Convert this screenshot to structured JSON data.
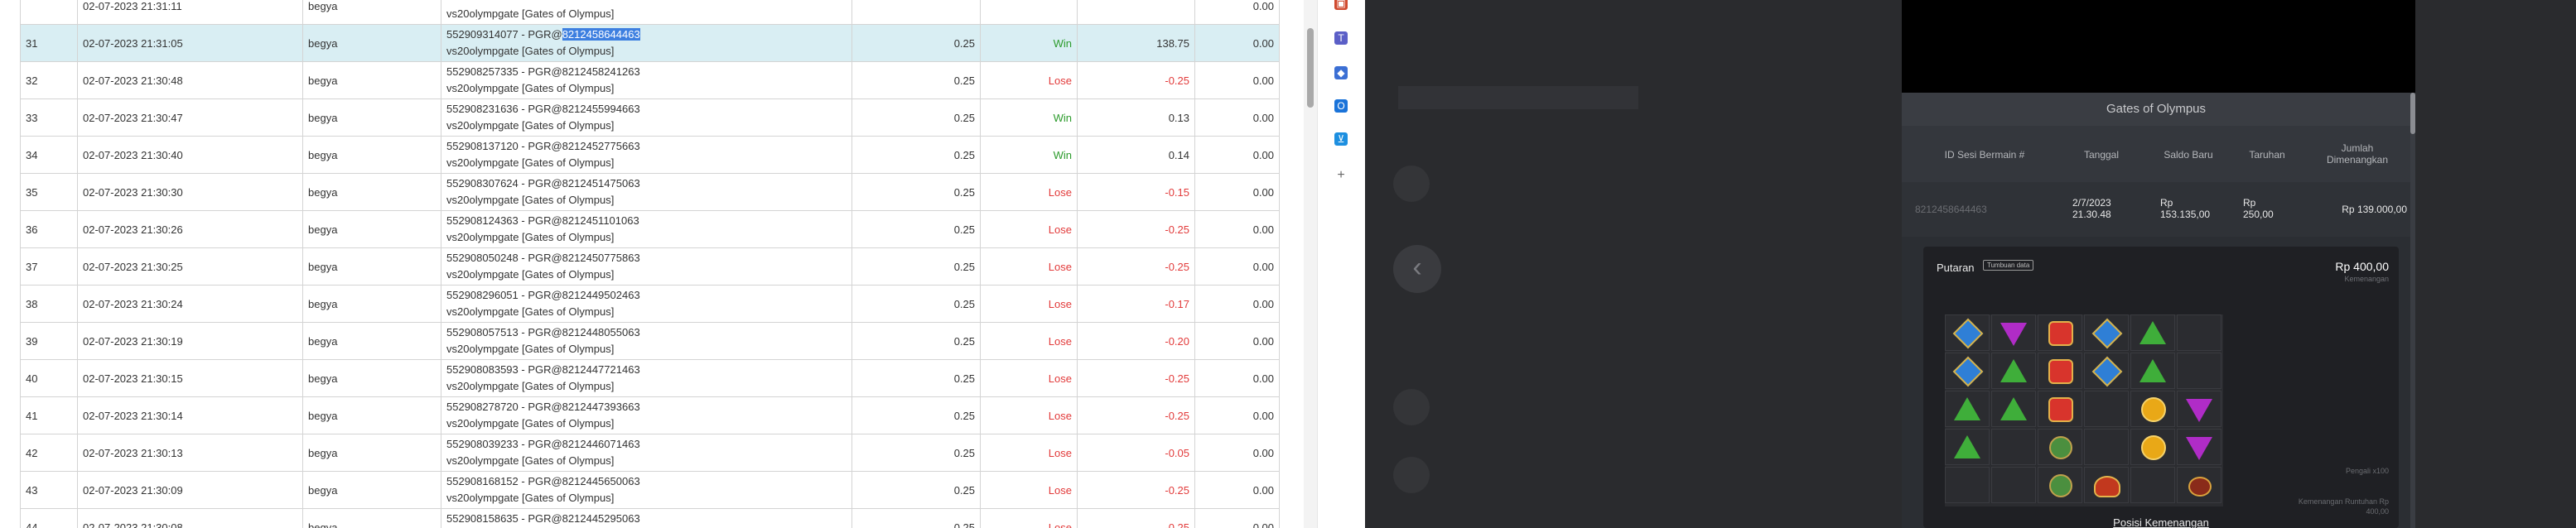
{
  "table": {
    "rows": [
      {
        "no": "31",
        "date": "02-07-2023 21:31:05",
        "user": "begya",
        "desc_pre": "552909314077 - PGR@",
        "desc_hl": "8212458644463",
        "desc2": "vs20olympgate [Gates of Olympus]",
        "bet": "0.25",
        "result": "Win",
        "amount": "138.75",
        "balance": "0.00"
      },
      {
        "no": "32",
        "date": "02-07-2023 21:30:48",
        "user": "begya",
        "desc1": "552908257335 - PGR@8212458241263",
        "desc2": "vs20olympgate [Gates of Olympus]",
        "bet": "0.25",
        "result": "Lose",
        "amount": "-0.25",
        "balance": "0.00"
      },
      {
        "no": "33",
        "date": "02-07-2023 21:30:47",
        "user": "begya",
        "desc1": "552908231636 - PGR@8212455994663",
        "desc2": "vs20olympgate [Gates of Olympus]",
        "bet": "0.25",
        "result": "Win",
        "amount": "0.13",
        "balance": "0.00"
      },
      {
        "no": "34",
        "date": "02-07-2023 21:30:40",
        "user": "begya",
        "desc1": "552908137120 - PGR@8212452775663",
        "desc2": "vs20olympgate [Gates of Olympus]",
        "bet": "0.25",
        "result": "Win",
        "amount": "0.14",
        "balance": "0.00"
      },
      {
        "no": "35",
        "date": "02-07-2023 21:30:30",
        "user": "begya",
        "desc1": "552908307624 - PGR@8212451475063",
        "desc2": "vs20olympgate [Gates of Olympus]",
        "bet": "0.25",
        "result": "Lose",
        "amount": "-0.15",
        "balance": "0.00"
      },
      {
        "no": "36",
        "date": "02-07-2023 21:30:26",
        "user": "begya",
        "desc1": "552908124363 - PGR@8212451101063",
        "desc2": "vs20olympgate [Gates of Olympus]",
        "bet": "0.25",
        "result": "Lose",
        "amount": "-0.25",
        "balance": "0.00"
      },
      {
        "no": "37",
        "date": "02-07-2023 21:30:25",
        "user": "begya",
        "desc1": "552908050248 - PGR@8212450775863",
        "desc2": "vs20olympgate [Gates of Olympus]",
        "bet": "0.25",
        "result": "Lose",
        "amount": "-0.25",
        "balance": "0.00"
      },
      {
        "no": "38",
        "date": "02-07-2023 21:30:24",
        "user": "begya",
        "desc1": "552908296051 - PGR@8212449502463",
        "desc2": "vs20olympgate [Gates of Olympus]",
        "bet": "0.25",
        "result": "Lose",
        "amount": "-0.17",
        "balance": "0.00"
      },
      {
        "no": "39",
        "date": "02-07-2023 21:30:19",
        "user": "begya",
        "desc1": "552908057513 - PGR@8212448055063",
        "desc2": "vs20olympgate [Gates of Olympus]",
        "bet": "0.25",
        "result": "Lose",
        "amount": "-0.20",
        "balance": "0.00"
      },
      {
        "no": "40",
        "date": "02-07-2023 21:30:15",
        "user": "begya",
        "desc1": "552908083593 - PGR@8212447721463",
        "desc2": "vs20olympgate [Gates of Olympus]",
        "bet": "0.25",
        "result": "Lose",
        "amount": "-0.25",
        "balance": "0.00"
      },
      {
        "no": "41",
        "date": "02-07-2023 21:30:14",
        "user": "begya",
        "desc1": "552908278720 - PGR@8212447393663",
        "desc2": "vs20olympgate [Gates of Olympus]",
        "bet": "0.25",
        "result": "Lose",
        "amount": "-0.25",
        "balance": "0.00"
      },
      {
        "no": "42",
        "date": "02-07-2023 21:30:13",
        "user": "begya",
        "desc1": "552908039233 - PGR@8212446071463",
        "desc2": "vs20olympgate [Gates of Olympus]",
        "bet": "0.25",
        "result": "Lose",
        "amount": "-0.05",
        "balance": "0.00"
      },
      {
        "no": "43",
        "date": "02-07-2023 21:30:09",
        "user": "begya",
        "desc1": "552908168152 - PGR@8212445650063",
        "desc2": "vs20olympgate [Gates of Olympus]",
        "bet": "0.25",
        "result": "Lose",
        "amount": "-0.25",
        "balance": "0.00"
      },
      {
        "no": "44",
        "date": "02-07-2023 21:30:08",
        "user": "begya",
        "desc1": "552908158635 - PGR@8212445295063",
        "desc2": "vs20olympgate [Gates of Olympus]",
        "bet": "0.25",
        "result": "Lose",
        "amount": "-0.25",
        "balance": "0.00"
      }
    ],
    "top_partial": {
      "date": "02-07-2023 21:31:11",
      "user": "begya",
      "desc2": "vs20olympgate [Gates of Olympus]",
      "balance": "0.00"
    }
  },
  "strip_icons": [
    {
      "name": "gift-icon",
      "glyph": "▣",
      "color": "#d04a2f"
    },
    {
      "name": "teams-icon",
      "glyph": "T",
      "color": "#5b5fc7"
    },
    {
      "name": "shield-icon",
      "glyph": "◆",
      "color": "#3b6fd4"
    },
    {
      "name": "outlook-icon",
      "glyph": "O",
      "color": "#1a73d9"
    },
    {
      "name": "cart-icon",
      "glyph": "⊻",
      "color": "#1d8fe0"
    },
    {
      "name": "add-icon",
      "glyph": "+",
      "color": "#666666"
    }
  ],
  "panel": {
    "title": "Gates of Olympus",
    "headers": {
      "id": "ID Sesi Bermain #",
      "date": "Tanggal",
      "balance": "Saldo Baru",
      "bet": "Taruhan",
      "win_line1": "Jumlah",
      "win_line2": "Dimenangkan"
    },
    "row": {
      "id": "8212458644463",
      "date_line1": "2/7/2023",
      "date_line2": "21.30.48",
      "balance_line1": "Rp",
      "balance_line2": "153.135,00",
      "bet_line1": "Rp",
      "bet_line2": "250,00",
      "win": "Rp 139.000,00"
    },
    "spin": {
      "label": "Putaran",
      "tag": "Tumbuan data",
      "amount": "Rp 400,00",
      "amount_sub": "Kemenangan",
      "pengali": "Pengali x100",
      "bonus_line1": "Kemenangan Runtuhan Rp",
      "bonus_line2": "400,00",
      "link": "Posisi Kemenangan"
    },
    "grid": [
      [
        "blue",
        "purple",
        "red",
        "blue",
        "green",
        ""
      ],
      [
        "blue",
        "green",
        "red",
        "blue",
        "green",
        ""
      ],
      [
        "green",
        "green",
        "red",
        "",
        "yellow",
        "purple"
      ],
      [
        "green",
        "",
        "wand",
        "",
        "yellow",
        "purple"
      ],
      [
        "",
        "",
        "wand",
        "crown",
        "",
        "ring"
      ]
    ]
  }
}
